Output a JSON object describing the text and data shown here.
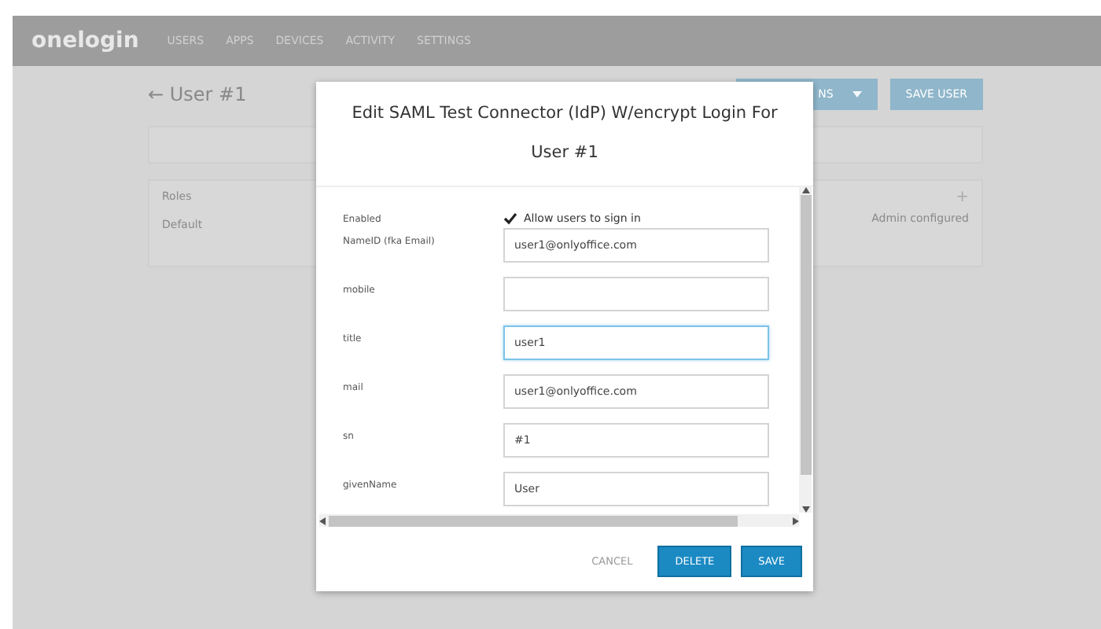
{
  "nav": {
    "logo": "onelogin",
    "items": [
      "USERS",
      "APPS",
      "DEVICES",
      "ACTIVITY",
      "SETTINGS"
    ]
  },
  "page": {
    "back_title": "← User #1",
    "actions_button": "NS",
    "save_button": "SAVE USER",
    "roles_label": "Roles",
    "default_label": "Default",
    "admin_text": "Admin configured",
    "add_icon": "+"
  },
  "modal": {
    "title": "Edit SAML Test Connector (IdP) W/encrypt Login For User #1",
    "fields": [
      {
        "kind": "checkbox",
        "label": "Enabled",
        "text": "Allow users to sign in",
        "checked": true
      },
      {
        "kind": "text",
        "label": "NameID (fka Email)",
        "value": "user1@onlyoffice.com",
        "focused": false
      },
      {
        "kind": "text",
        "label": "mobile",
        "focused": false
      },
      {
        "kind": "text",
        "label": "title",
        "value": "user1",
        "focused": true
      },
      {
        "kind": "text",
        "label": "mail",
        "value": "user1@onlyoffice.com",
        "focused": false
      },
      {
        "kind": "text",
        "label": "sn",
        "value": "#1",
        "focused": false
      },
      {
        "kind": "text",
        "label": "givenName",
        "value": "User",
        "focused": false
      }
    ],
    "buttons": [
      {
        "kind": "link",
        "label": "CANCEL"
      },
      {
        "kind": "primary",
        "label": "DELETE"
      },
      {
        "kind": "primary",
        "label": "SAVE"
      }
    ]
  }
}
